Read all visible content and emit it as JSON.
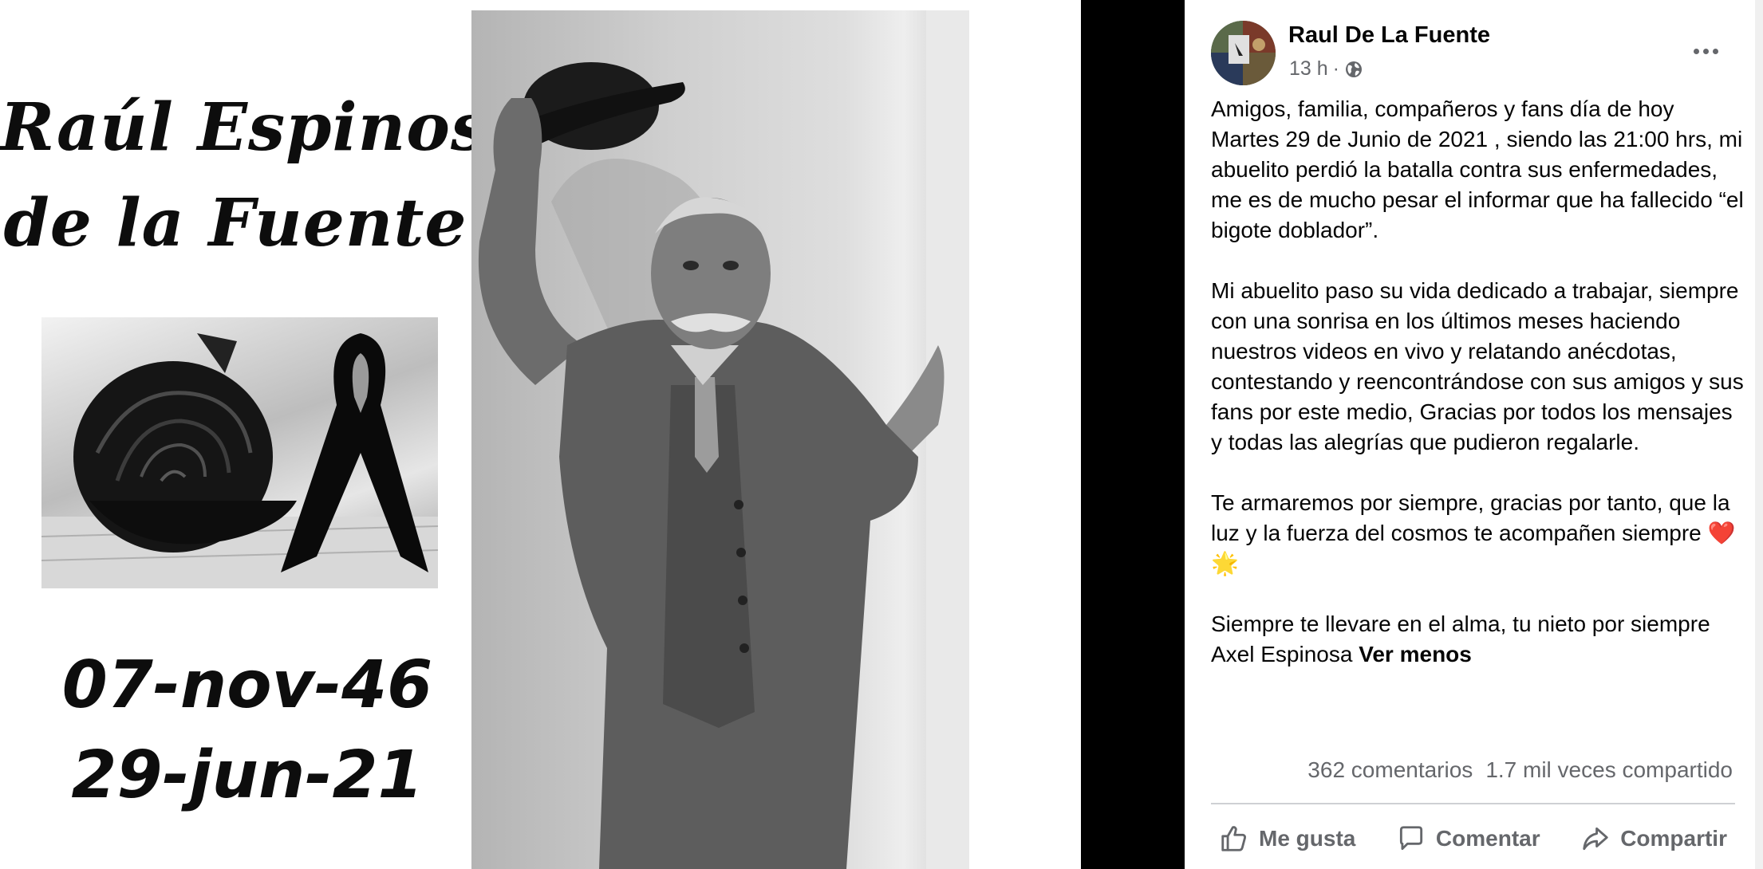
{
  "memorial": {
    "name_line1": "Raúl Espinosa",
    "name_line2": "de la Fuente",
    "birth_date": "07-nov-46",
    "death_date": "29-jun-21"
  },
  "post": {
    "author": "Raul De La Fuente",
    "time": "13 h",
    "separator": "·",
    "privacy_icon": "globe-icon",
    "paragraphs": [
      "Amigos, familia, compañeros y fans día de hoy Martes 29 de Junio de 2021 , siendo las 21:00 hrs, mi abuelito perdió la batalla contra sus enfermedades, me es de mucho pesar el informar que ha fallecido “el bigote doblador”.",
      "Mi abuelito paso su vida dedicado a trabajar, siempre con una sonrisa en los últimos meses haciendo nuestros videos en vivo y relatando anécdotas, contestando y reencontrándose con sus amigos y sus fans por este medio, Gracias por todos los mensajes y todas las alegrías que pudieron regalarle.",
      "Te armaremos por siempre, gracias por tanto, que la luz y la fuerza del cosmos te acompañen siempre ❤️🌟",
      "Siempre te llevare en el alma, tu nieto por siempre Axel Espinosa"
    ],
    "see_less": "Ver menos",
    "comments_count": "362 comentarios",
    "shares_count": "1.7 mil veces compartido",
    "actions": {
      "like": "Me gusta",
      "comment": "Comentar",
      "share": "Compartir"
    }
  },
  "colors": {
    "text_primary": "#050505",
    "text_secondary": "#65676b",
    "divider": "#ced0d4",
    "separator_band": "#000000"
  }
}
